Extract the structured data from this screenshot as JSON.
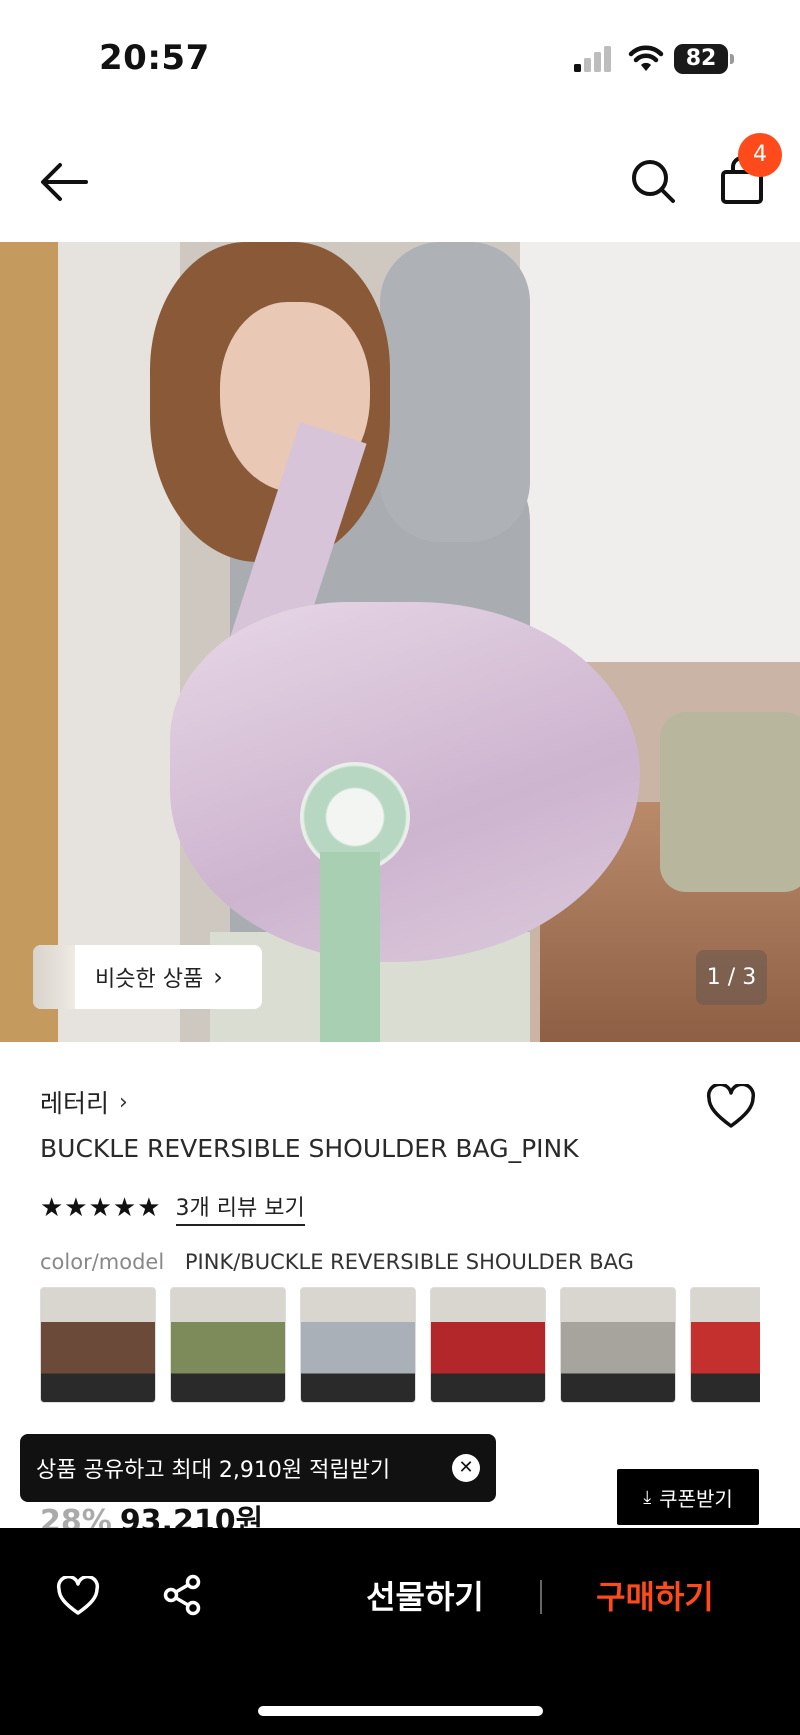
{
  "status_bar": {
    "time": "20:57",
    "battery": "82"
  },
  "header": {
    "cart_count": "4"
  },
  "hero": {
    "similar_label": "비슷한 상품",
    "page_indicator": "1 / 3"
  },
  "product": {
    "brand": "레터리",
    "title": "BUCKLE REVERSIBLE SHOULDER BAG_PINK",
    "stars": "★★★★★",
    "review_link": "3개 리뷰 보기",
    "option_label": "color/model",
    "option_value": "PINK/BUCKLE REVERSIBLE SHOULDER BAG",
    "swatch_colors": [
      "#6b4a3a",
      "#7d8a5a",
      "#a9b0b8",
      "#b3262a",
      "#a7a39d",
      "#c4302d"
    ],
    "discount": "28%",
    "price": "93,210원"
  },
  "toast": {
    "message": "상품 공유하고 최대 2,910원 적립받기"
  },
  "coupon": {
    "label": "쿠폰받기"
  },
  "bottom_bar": {
    "gift_label": "선물하기",
    "buy_label": "구매하기"
  },
  "colors": {
    "accent": "#ff4a1c",
    "black": "#000000"
  }
}
